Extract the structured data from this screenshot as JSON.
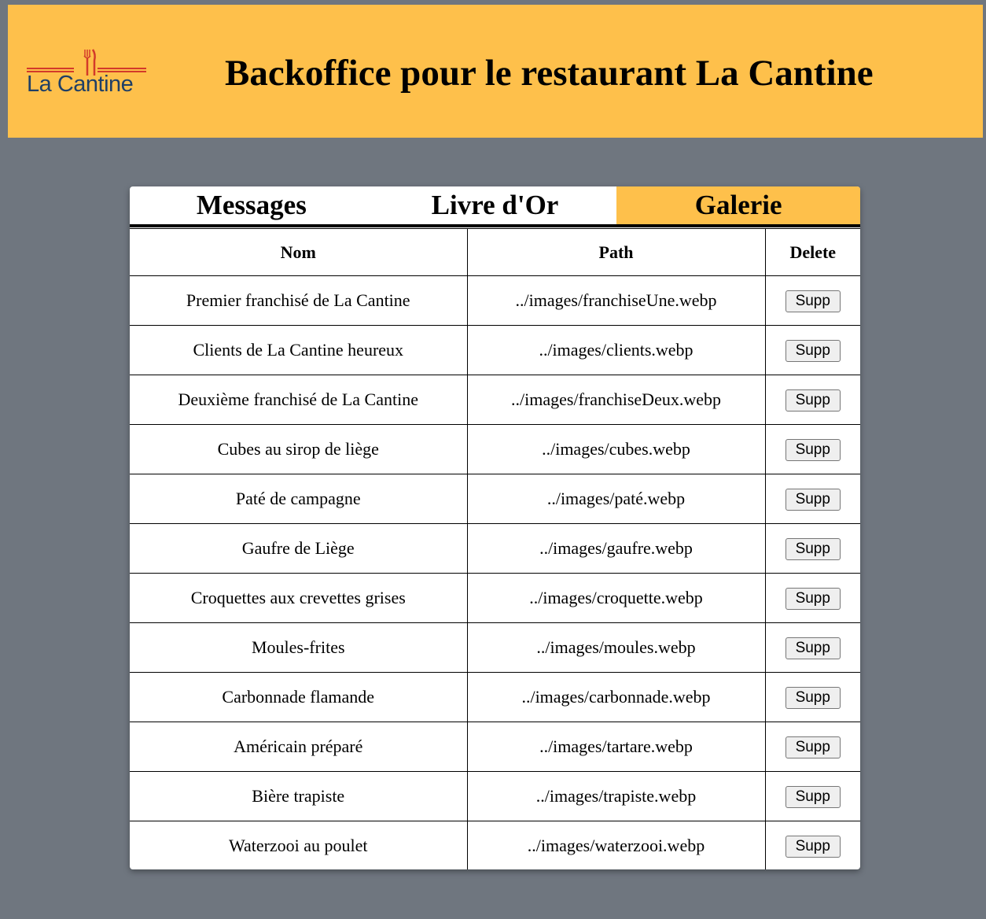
{
  "header": {
    "logo_text": "La Cantine",
    "title": "Backoffice pour le restaurant La Cantine"
  },
  "tabs": [
    {
      "label": "Messages",
      "active": false
    },
    {
      "label": "Livre d'Or",
      "active": false
    },
    {
      "label": "Galerie",
      "active": true
    }
  ],
  "table": {
    "headers": {
      "name": "Nom",
      "path": "Path",
      "delete": "Delete"
    },
    "rows": [
      {
        "name": "Premier franchisé de La Cantine",
        "path": "../images/franchiseUne.webp",
        "action": "Supp"
      },
      {
        "name": "Clients de La Cantine heureux",
        "path": "../images/clients.webp",
        "action": "Supp"
      },
      {
        "name": "Deuxième franchisé de La Cantine",
        "path": "../images/franchiseDeux.webp",
        "action": "Supp"
      },
      {
        "name": "Cubes au sirop de liège",
        "path": "../images/cubes.webp",
        "action": "Supp"
      },
      {
        "name": "Paté de campagne",
        "path": "../images/paté.webp",
        "action": "Supp"
      },
      {
        "name": "Gaufre de Liège",
        "path": "../images/gaufre.webp",
        "action": "Supp"
      },
      {
        "name": "Croquettes aux crevettes grises",
        "path": "../images/croquette.webp",
        "action": "Supp"
      },
      {
        "name": "Moules-frites",
        "path": "../images/moules.webp",
        "action": "Supp"
      },
      {
        "name": "Carbonnade flamande",
        "path": "../images/carbonnade.webp",
        "action": "Supp"
      },
      {
        "name": "Américain préparé",
        "path": "../images/tartare.webp",
        "action": "Supp"
      },
      {
        "name": "Bière trapiste",
        "path": "../images/trapiste.webp",
        "action": "Supp"
      },
      {
        "name": "Waterzooi au poulet",
        "path": "../images/waterzooi.webp",
        "action": "Supp"
      }
    ]
  },
  "colors": {
    "accent": "#fec04b",
    "background": "#6f767f",
    "logo_text": "#1f3f66",
    "logo_lines": "#d33a2a"
  }
}
